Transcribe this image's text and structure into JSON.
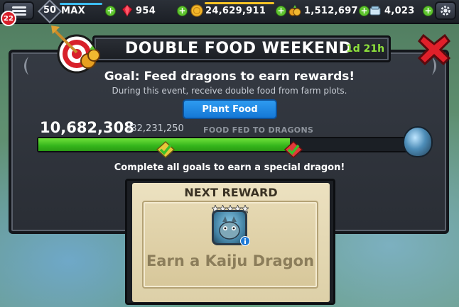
{
  "hud": {
    "notification_count": "22",
    "player_level": "50",
    "xp_label": "MAX",
    "gems": "954",
    "gold": "24,629,911",
    "food": "1,512,697",
    "elixir": "4,023",
    "plus_symbol": "+"
  },
  "event": {
    "title": "DOUBLE FOOD WEEKEND",
    "timer": "1d 21h",
    "goal": "Goal: Feed dragons to earn rewards!",
    "description": "During this event, receive double food from farm plots.",
    "plant_button_label": "Plant Food"
  },
  "progress": {
    "current": "10,682,308",
    "total": "/32,231,250",
    "label": "FOOD FED TO DRAGONS",
    "fill_fraction": 0.68,
    "complete_hint": "Complete all goals to earn a special dragon!"
  },
  "reward": {
    "header": "NEXT REWARD",
    "text": "Earn a Kaiju Dragon",
    "stars": 5
  },
  "colors": {
    "progress_green": "#34b51b",
    "timer_green": "#8fe33c",
    "button_blue": "#1578d6",
    "close_red": "#e0202a"
  }
}
